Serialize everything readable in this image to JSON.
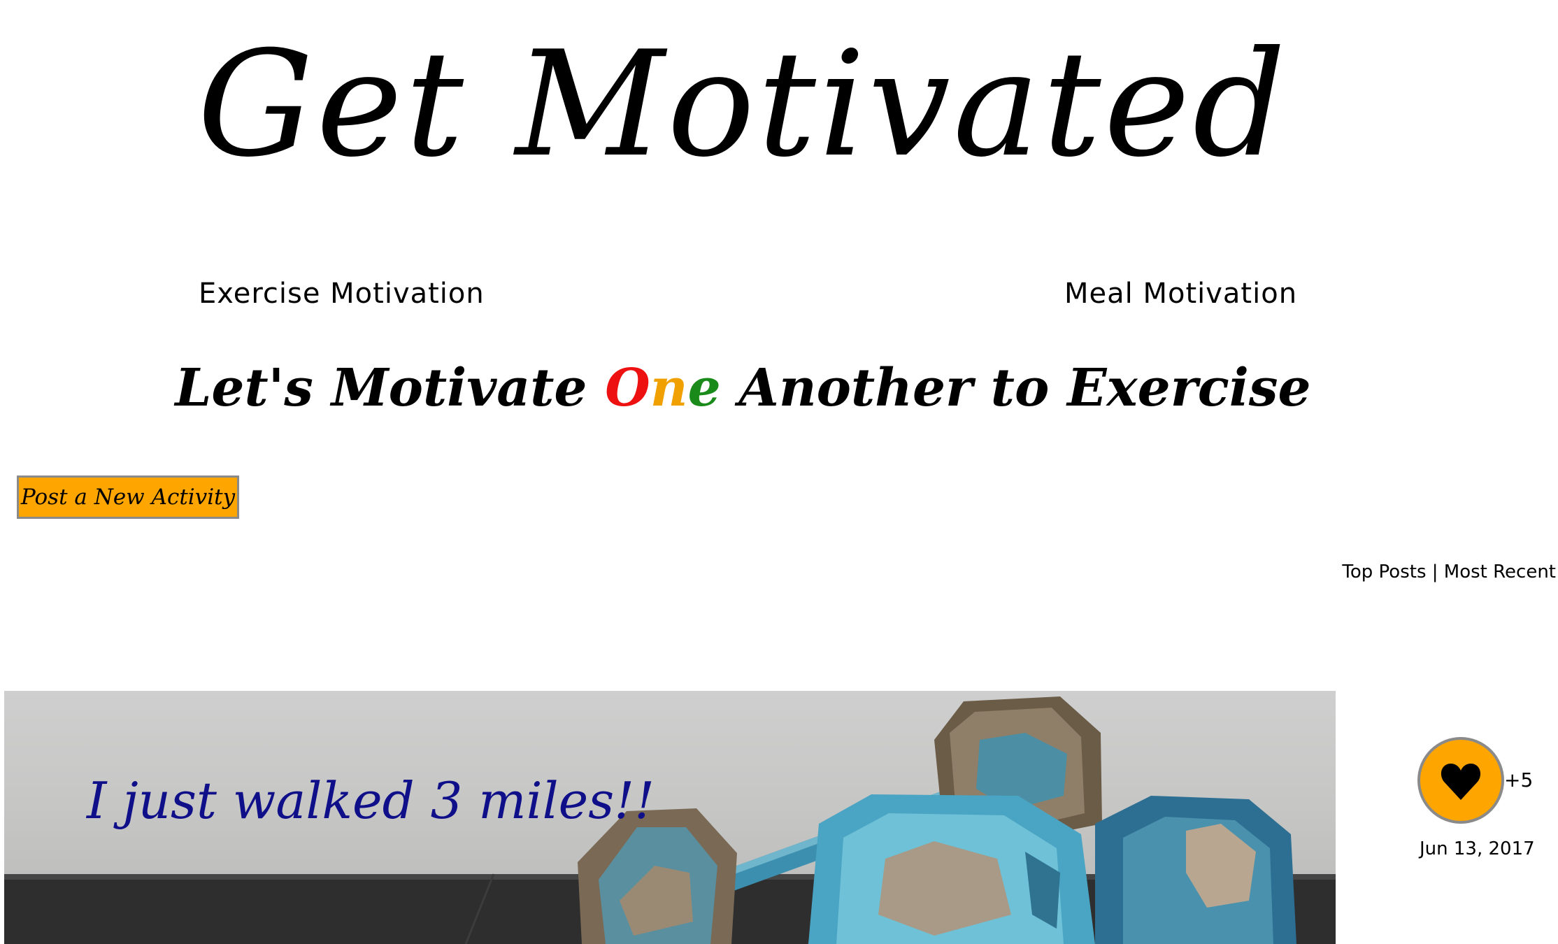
{
  "header": {
    "site_title": "Get Motivated"
  },
  "nav": {
    "exercise_label": "Exercise Motivation",
    "meal_label": "Meal Motivation"
  },
  "tagline": {
    "before": "Let's Motivate ",
    "o": "O",
    "n": "n",
    "e": "e",
    "after": " Another to Exercise"
  },
  "actions": {
    "post_button_label": "Post a New Activity"
  },
  "sort": {
    "top_posts_label": "Top Posts",
    "separator": "|",
    "most_recent_label": "Most Recent"
  },
  "post": {
    "text": "I just walked 3 miles!!",
    "image_icon": "dumbbells-image",
    "like_icon": "heart-icon",
    "like_count": "+5",
    "date": "Jun 13, 2017"
  },
  "colors": {
    "accent": "#ffa500",
    "post_text": "#0f0f8a",
    "tagline_o": "#ee1111",
    "tagline_n": "#f0a000",
    "tagline_e": "#1a8a1a"
  }
}
